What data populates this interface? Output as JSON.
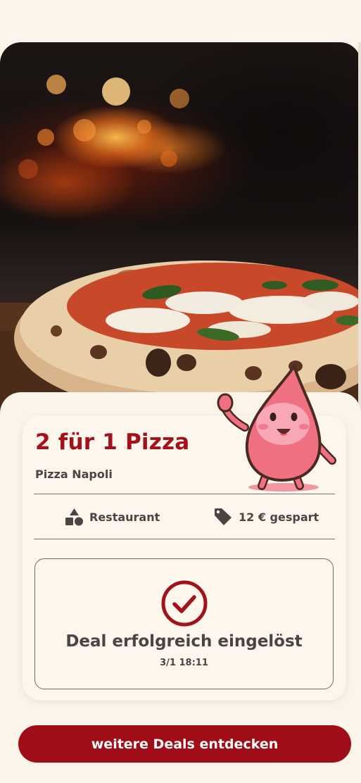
{
  "hero": {
    "image": "pizza-in-wood-fired-oven-photo"
  },
  "deal": {
    "title": "2 für 1 Pizza",
    "vendor": "Pizza Napoli",
    "category_label": "Restaurant",
    "category_icon": "shapes-icon",
    "savings_label": "12 € gespart",
    "savings_icon": "price-tag-icon"
  },
  "status": {
    "icon": "check-circle-icon",
    "message": "Deal erfolgreich eingelöst",
    "timestamp": "3/1 18:11"
  },
  "cta": {
    "label": "weitere Deals entdecken"
  },
  "colors": {
    "accent": "#9f0e17",
    "title": "#a1121c",
    "background": "#fbf4ea",
    "text": "#4a4445",
    "mascot": "#f0707e"
  }
}
